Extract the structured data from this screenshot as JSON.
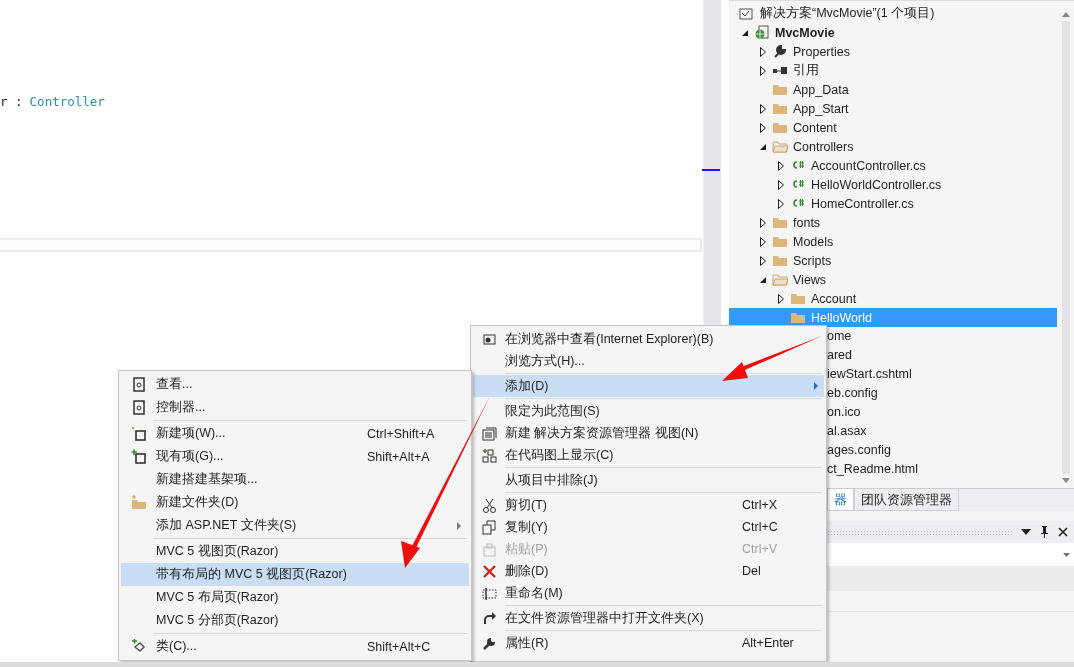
{
  "editor": {
    "code_line": [
      {
        "text": "r :",
        "kind": "plain"
      },
      {
        "text": "Controller",
        "kind": "type"
      }
    ]
  },
  "solution_explorer": {
    "tree": [
      {
        "label": "解决方案“MvcMovie”(1 个项目)",
        "kind": "solution",
        "selected": false,
        "children": [
          {
            "label": "MvcMovie",
            "kind": "project",
            "expanded": true,
            "selected": false,
            "children": [
              {
                "label": "Properties",
                "kind": "wrench",
                "expanded": false,
                "selected": false
              },
              {
                "label": "引用",
                "kind": "references",
                "expanded": false,
                "selected": false
              },
              {
                "label": "App_Data",
                "kind": "folder",
                "selected": false
              },
              {
                "label": "App_Start",
                "kind": "folder",
                "expanded": false,
                "selected": false
              },
              {
                "label": "Content",
                "kind": "folder",
                "expanded": false,
                "selected": false
              },
              {
                "label": "Controllers",
                "kind": "folder",
                "expanded": true,
                "selected": false,
                "children": [
                  {
                    "label": "AccountController.cs",
                    "kind": "csharp",
                    "expanded": false,
                    "selected": false
                  },
                  {
                    "label": "HelloWorldController.cs",
                    "kind": "csharp",
                    "expanded": false,
                    "selected": false
                  },
                  {
                    "label": "HomeController.cs",
                    "kind": "csharp",
                    "expanded": false,
                    "selected": false
                  }
                ]
              },
              {
                "label": "fonts",
                "kind": "folder",
                "expanded": false,
                "selected": false
              },
              {
                "label": "Models",
                "kind": "folder",
                "expanded": false,
                "selected": false
              },
              {
                "label": "Scripts",
                "kind": "folder",
                "expanded": false,
                "selected": false
              },
              {
                "label": "Views",
                "kind": "folder",
                "expanded": true,
                "selected": false,
                "children": [
                  {
                    "label": "Account",
                    "kind": "folder",
                    "expanded": false,
                    "selected": false
                  },
                  {
                    "label": "HelloWorld",
                    "kind": "folder",
                    "selected": true
                  }
                ]
              }
            ]
          }
        ]
      }
    ],
    "covered_rows": [
      "ome",
      "ared",
      "iewStart.cshtml",
      "eb.config",
      "on.ico",
      "al.asax",
      "ages.config",
      "ct_Readme.html"
    ],
    "tabs": [
      {
        "label": "器",
        "selected": true
      },
      {
        "label": "团队资源管理器",
        "selected": false
      }
    ]
  },
  "context_menu": {
    "items": [
      {
        "kind": "item",
        "label": "在浏览器中查看(Internet Explorer)(B)",
        "selected": false,
        "disabled": false
      },
      {
        "kind": "item",
        "label": "浏览方式(H)...",
        "selected": false,
        "disabled": false
      },
      {
        "kind": "separator"
      },
      {
        "kind": "item",
        "label": "添加(D)",
        "selected": true,
        "disabled": false,
        "has_submenu": true
      },
      {
        "kind": "separator"
      },
      {
        "kind": "item",
        "label": "限定为此范围(S)",
        "selected": false,
        "disabled": false
      },
      {
        "kind": "item",
        "label": "新建 解决方案资源管理器 视图(N)",
        "selected": false,
        "disabled": false
      },
      {
        "kind": "item",
        "label": "在代码图上显示(C)",
        "selected": false,
        "disabled": false
      },
      {
        "kind": "separator"
      },
      {
        "kind": "item",
        "label": "从项目中排除(J)",
        "selected": false,
        "disabled": false
      },
      {
        "kind": "separator"
      },
      {
        "kind": "item",
        "label": "剪切(T)",
        "shortcut": "Ctrl+X",
        "selected": false,
        "disabled": false
      },
      {
        "kind": "item",
        "label": "复制(Y)",
        "shortcut": "Ctrl+C",
        "selected": false,
        "disabled": false
      },
      {
        "kind": "item",
        "label": "粘贴(P)",
        "shortcut": "Ctrl+V",
        "selected": false,
        "disabled": true
      },
      {
        "kind": "item",
        "label": "删除(D)",
        "shortcut": "Del",
        "selected": false,
        "disabled": false
      },
      {
        "kind": "item",
        "label": "重命名(M)",
        "selected": false,
        "disabled": false
      },
      {
        "kind": "separator"
      },
      {
        "kind": "item",
        "label": "在文件资源管理器中打开文件夹(X)",
        "selected": false,
        "disabled": false
      },
      {
        "kind": "separator"
      },
      {
        "kind": "item",
        "label": "属性(R)",
        "shortcut": "Alt+Enter",
        "selected": false,
        "disabled": false
      }
    ]
  },
  "submenu": {
    "items": [
      {
        "kind": "item",
        "label": "查看...",
        "selected": false,
        "disabled": false
      },
      {
        "kind": "item",
        "label": "控制器...",
        "selected": false,
        "disabled": false
      },
      {
        "kind": "separator"
      },
      {
        "kind": "item",
        "label": "新建项(W)...",
        "shortcut": "Ctrl+Shift+A",
        "selected": false,
        "disabled": false
      },
      {
        "kind": "item",
        "label": "现有项(G)...",
        "shortcut": "Shift+Alt+A",
        "selected": false,
        "disabled": false
      },
      {
        "kind": "item",
        "label": "新建搭建基架项...",
        "selected": false,
        "disabled": false
      },
      {
        "kind": "item",
        "label": "新建文件夹(D)",
        "selected": false,
        "disabled": false
      },
      {
        "kind": "item",
        "label": "添加 ASP.NET 文件夹(S)",
        "selected": false,
        "disabled": false,
        "has_submenu": true
      },
      {
        "kind": "separator"
      },
      {
        "kind": "item",
        "label": "MVC 5 视图页(Razor)",
        "selected": false,
        "disabled": false
      },
      {
        "kind": "item",
        "label": "带有布局的 MVC 5 视图页(Razor)",
        "selected": true,
        "disabled": false
      },
      {
        "kind": "item",
        "label": "MVC 5 布局页(Razor)",
        "selected": false,
        "disabled": false
      },
      {
        "kind": "item",
        "label": "MVC 5 分部页(Razor)",
        "selected": false,
        "disabled": false
      },
      {
        "kind": "separator"
      },
      {
        "kind": "item",
        "label": "类(C)...",
        "shortcut": "Shift+Alt+C",
        "selected": false,
        "disabled": false
      }
    ]
  }
}
